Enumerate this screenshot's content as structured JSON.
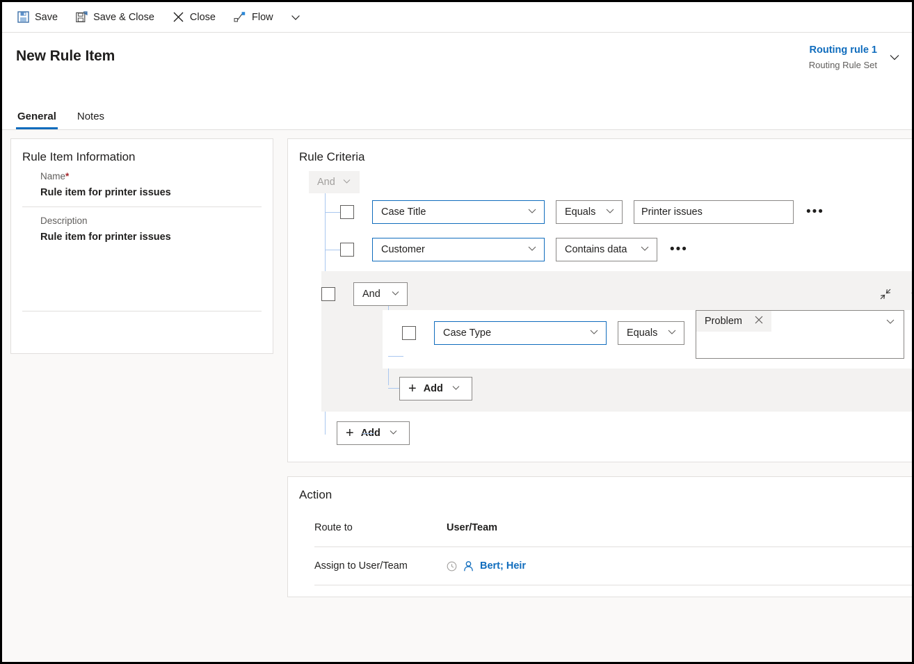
{
  "commandbar": {
    "items": [
      {
        "label": "Save",
        "icon": "save-icon"
      },
      {
        "label": "Save & Close",
        "icon": "save-and-close-icon"
      },
      {
        "label": "Close",
        "icon": "close-x-icon"
      },
      {
        "label": "Flow",
        "icon": "flow-icon"
      }
    ],
    "overflow_icon": "chevron-down-icon"
  },
  "header": {
    "title": "New Rule Item",
    "record": {
      "name": "Routing rule 1",
      "type": "Routing Rule Set"
    },
    "expand_icon": "chevron-down-icon",
    "tabs": [
      {
        "label": "General",
        "active": true
      },
      {
        "label": "Notes",
        "active": false
      }
    ]
  },
  "rule_item_information": {
    "title": "Rule Item Information",
    "fields": [
      {
        "label": "Name",
        "required": "*",
        "value": "Rule item for printer issues"
      },
      {
        "label": "Description",
        "required": "",
        "value": "Rule item for printer issues"
      }
    ]
  },
  "rule_criteria": {
    "title": "Rule Criteria",
    "root_operator": "And",
    "rows": [
      {
        "field": "Case Title",
        "operator": "Equals",
        "value": "Printer issues",
        "has_value_box": true,
        "more_label": "•••"
      },
      {
        "field": "Customer",
        "operator": "Contains data",
        "value": "",
        "has_value_box": false,
        "more_label": "•••"
      }
    ],
    "group": {
      "operator": "And",
      "collapse_icon": "collapse-icon",
      "more_label": "•••",
      "row": {
        "field": "Case Type",
        "operator": "Equals",
        "tag": "Problem",
        "tag_remove": "×",
        "more_label": "•••"
      },
      "add_label": "Add"
    },
    "add_label": "Add"
  },
  "action": {
    "title": "Action",
    "rows": [
      {
        "label": "Route to",
        "value": "User/Team"
      },
      {
        "label": "Assign to User/Team",
        "value": "Bert; Heir"
      }
    ]
  },
  "colors": {
    "accent": "#0f6cbd",
    "required": "#a4262c",
    "tree_line": "#a9c7ef",
    "panel_bg": "#faf9f8",
    "group_bg": "#f3f2f1"
  }
}
